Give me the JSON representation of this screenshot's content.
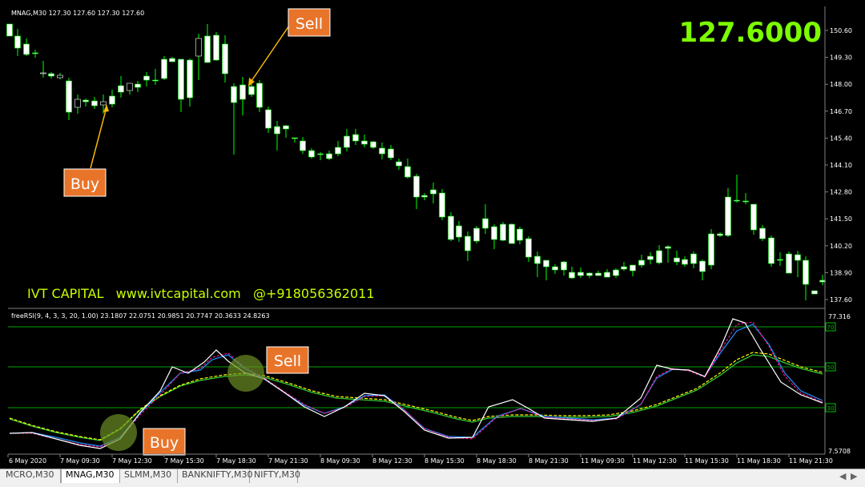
{
  "window": {
    "symbol_info": "MNAG,M30  127.30 127.60 127.30 127.60",
    "big_price": "127.6000",
    "branding": "IVT CAPITAL   www.ivtcapital.com   @+918056362011"
  },
  "callouts": {
    "buy_top": "Buy",
    "sell_top": "Sell",
    "buy_bottom": "Buy",
    "sell_bottom": "Sell"
  },
  "indicator": {
    "label": "freeRSI(9, 4, 3, 3, 20, 1.00) 23.1807 22.0751 20.9851 20.7747 20.3633 24.8263",
    "scale_top": "77.316",
    "scale_bottom": "7.5708",
    "levels": [
      "70",
      "50",
      "30"
    ]
  },
  "price_axis": [
    "150.60",
    "149.30",
    "148.00",
    "146.70",
    "145.40",
    "144.10",
    "142.80",
    "141.50",
    "140.20",
    "138.90",
    "137.60"
  ],
  "time_axis": [
    "6 May 2020",
    "7 May 09:30",
    "7 May 12:30",
    "7 May 15:30",
    "7 May 18:30",
    "7 May 21:30",
    "8 May 09:30",
    "8 May 12:30",
    "8 May 15:30",
    "8 May 18:30",
    "8 May 21:30",
    "11 May 09:30",
    "11 May 12:30",
    "11 May 15:30",
    "11 May 18:30",
    "11 May 21:30"
  ],
  "tabs": [
    {
      "label": "MCRO,M30",
      "active": false
    },
    {
      "label": "MNAG,M30",
      "active": true
    },
    {
      "label": "SLMM,M30",
      "active": false
    },
    {
      "label": "BANKNIFTY,M30",
      "active": false
    },
    {
      "label": "NIFTY,M30",
      "active": false
    }
  ],
  "tab_nav": [
    "◀",
    "▶"
  ],
  "colors": {
    "background": "#000000",
    "bull_body": "#ffffff",
    "wick": "#00ff00",
    "big_price": "#7cfc00",
    "branding": "#c8ff00",
    "callout_bg": "#e8742a",
    "arrow": "#f5b800",
    "osc_white": "#ffffff",
    "osc_blue": "#1e90ff",
    "osc_magenta": "#ff1493",
    "osc_yellow": "#ffff00",
    "osc_green": "#32cd32",
    "level_line": "#00a000"
  }
}
